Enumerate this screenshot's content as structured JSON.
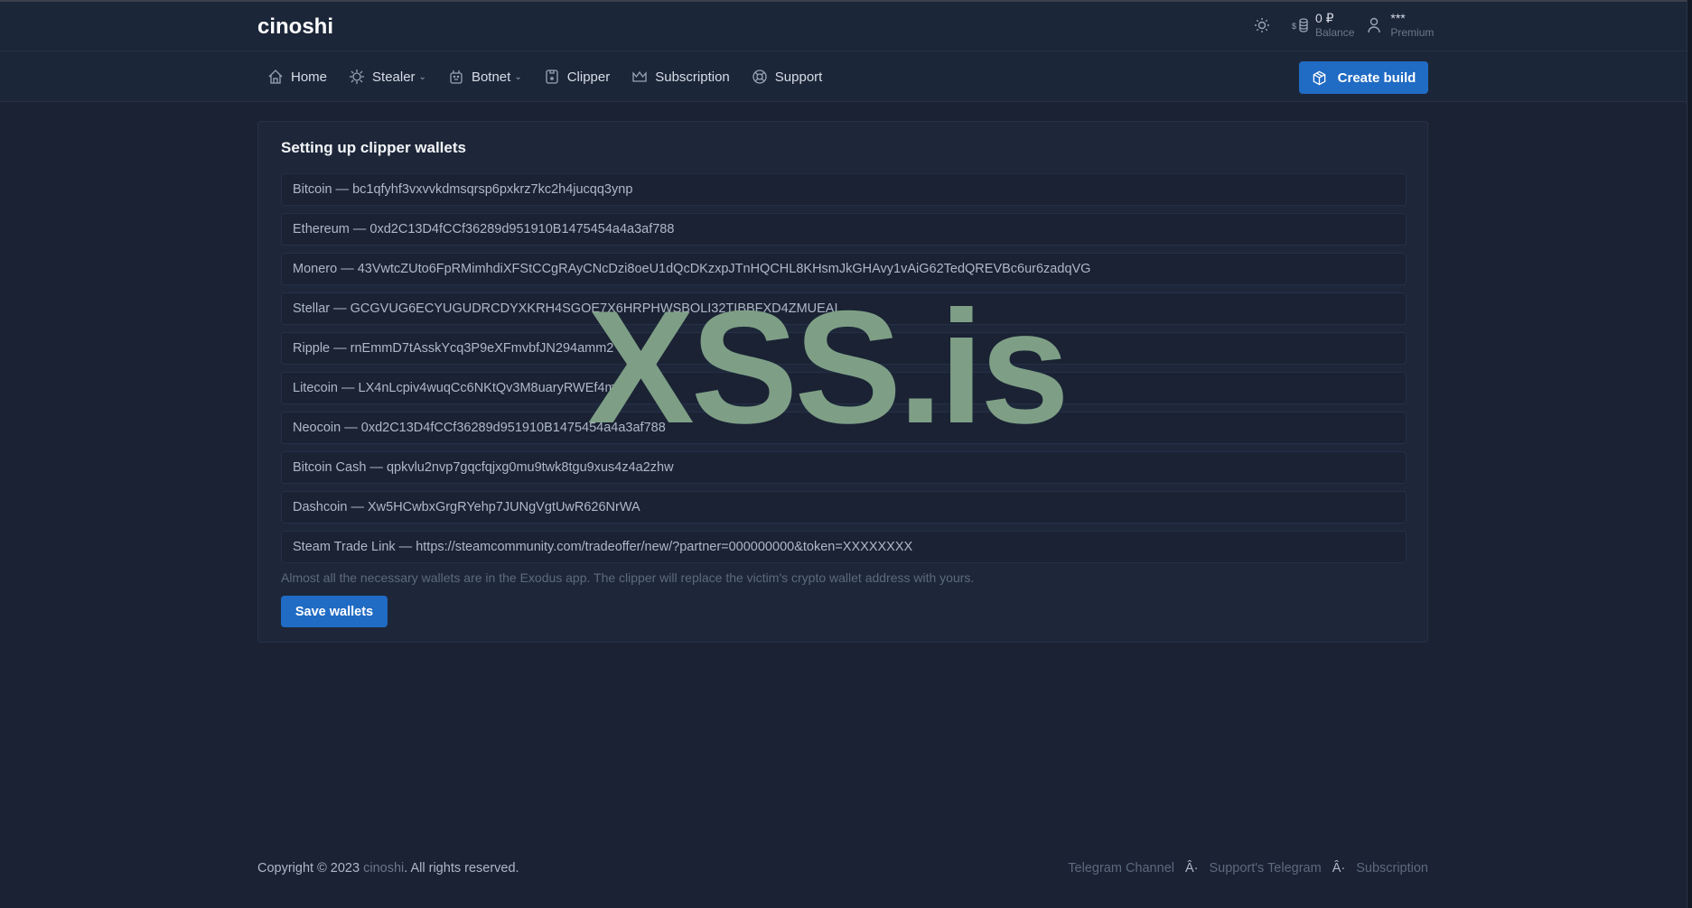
{
  "header": {
    "logo": "cinoshi",
    "balance_value": "0 ₽",
    "balance_label": "Balance",
    "user_name": "***",
    "user_plan": "Premium"
  },
  "nav": {
    "items": [
      {
        "label": "Home",
        "icon": "home-icon"
      },
      {
        "label": "Stealer",
        "icon": "bug-icon",
        "dropdown": true
      },
      {
        "label": "Botnet",
        "icon": "robot-icon",
        "dropdown": true
      },
      {
        "label": "Clipper",
        "icon": "clipboard-icon"
      },
      {
        "label": "Subscription",
        "icon": "crown-icon"
      },
      {
        "label": "Support",
        "icon": "lifebuoy-icon"
      }
    ],
    "create_build": "Create build"
  },
  "card": {
    "title": "Setting up clipper wallets",
    "wallets": [
      "Bitcoin — bc1qfyhf3vxvvkdmsqrsp6pxkrz7kc2h4jucqq3ynp",
      "Ethereum — 0xd2C13D4fCCf36289d951910B1475454a4a3af788",
      "Monero — 43VwtcZUto6FpRMimhdiXFStCCgRAyCNcDzi8oeU1dQcDKzxpJTnHQCHL8KHsmJkGHAvy1vAiG62TedQREVBc6ur6zadqVG",
      "Stellar — GCGVUG6ECYUGUDRCDYXKRH4SGOE7X6HRPHWSBOLI32TIBBFXD4ZMUEAI",
      "Ripple — rnEmmD7tAsskYcq3P9eXFmvbfJN294amm2",
      "Litecoin — LX4nLcpiv4wuqCc6NKtQv3M8uaryRWEf4m",
      "Neocoin — 0xd2C13D4fCCf36289d951910B1475454a4a3af788",
      "Bitcoin Cash — qpkvlu2nvp7gqcfqjxg0mu9twk8tgu9xus4z4a2zhw",
      "Dashcoin — Xw5HCwbxGrgRYehp7JUNgVgtUwR626NrWA",
      "Steam Trade Link — https://steamcommunity.com/tradeoffer/new/?partner=000000000&token=XXXXXXXX"
    ],
    "hint": "Almost all the necessary wallets are in the Exodus app. The clipper will replace the victim's crypto wallet address with yours.",
    "save": "Save wallets"
  },
  "footer": {
    "copyright_pre": "Copyright © 2023 ",
    "brand": "cinoshi",
    "copyright_post": ". All rights reserved.",
    "links": [
      "Telegram Channel",
      "Support's Telegram",
      "Subscription"
    ],
    "separator": "Â·"
  },
  "watermark": "XSS.is",
  "colors": {
    "accent": "#206bc4",
    "background": "#1a2233",
    "watermark": "#7e9f86"
  }
}
